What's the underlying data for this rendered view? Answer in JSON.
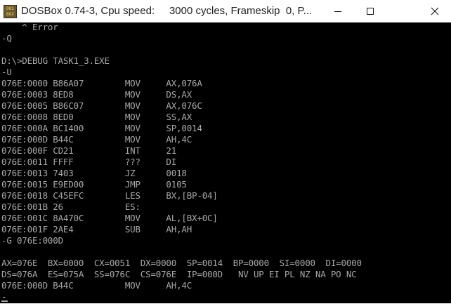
{
  "window": {
    "title": "DOSBox 0.74-3, Cpu speed:     3000 cycles, Frameskip  0, P...",
    "icon_text": "DOS BOX",
    "icon": "dosbox-app-icon",
    "minimize_icon": "minimize-icon",
    "maximize_icon": "maximize-icon",
    "close_icon": "close-icon"
  },
  "console": {
    "lines": [
      "    ^ Error",
      "-Q",
      "",
      "D:\\>DEBUG TASK1_3.EXE",
      "-U",
      "076E:0000 B86A07        MOV     AX,076A",
      "076E:0003 8ED8          MOV     DS,AX",
      "076E:0005 B86C07        MOV     AX,076C",
      "076E:0008 8ED0          MOV     SS,AX",
      "076E:000A BC1400        MOV     SP,0014",
      "076E:000D B44C          MOV     AH,4C",
      "076E:000F CD21          INT     21",
      "076E:0011 FFFF          ???     DI",
      "076E:0013 7403          JZ      0018",
      "076E:0015 E9ED00        JMP     0105",
      "076E:0018 C45EFC        LES     BX,[BP-04]",
      "076E:001B 26            ES:",
      "076E:001C 8A470C        MOV     AL,[BX+0C]",
      "076E:001F 2AE4          SUB     AH,AH",
      "-G 076E:000D",
      "",
      "AX=076E  BX=0000  CX=0051  DX=0000  SP=0014  BP=0000  SI=0000  DI=0000",
      "DS=076A  ES=075A  SS=076C  CS=076E  IP=000D   NV UP EI PL NZ NA PO NC",
      "076E:000D B44C          MOV     AH,4C",
      "-"
    ]
  },
  "colors": {
    "console_background": "#000000",
    "console_text": "#a8a8a8",
    "titlebar_background": "#ffffff"
  }
}
